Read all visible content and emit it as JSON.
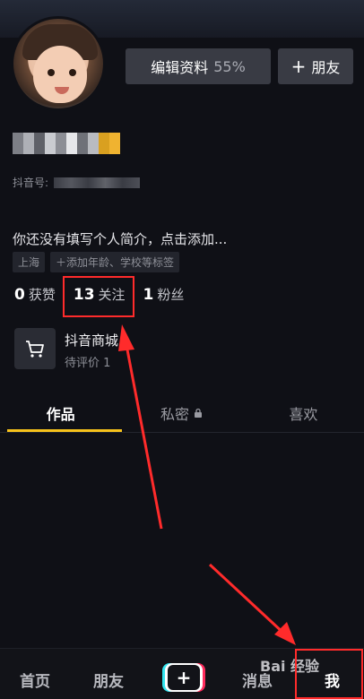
{
  "profile": {
    "edit_label": "编辑资料",
    "edit_percent": "55%",
    "friend_label": "朋友",
    "douyin_id_label": "抖音号:",
    "bio": "你还没有填写个人简介，点击添加...",
    "tags": [
      "上海",
      "＋添加年龄、学校等标签"
    ]
  },
  "stats": [
    {
      "num": "0",
      "label": "获赞"
    },
    {
      "num": "13",
      "label": "关注"
    },
    {
      "num": "1",
      "label": "粉丝"
    }
  ],
  "shop": {
    "title": "抖音商城",
    "subtitle": "待评价 1"
  },
  "tabs": [
    "作品",
    "私密",
    "喜欢"
  ],
  "nav": {
    "home": "首页",
    "friends": "朋友",
    "messages": "消息",
    "me": "我"
  },
  "watermark": "Bai 经验",
  "colors": {
    "accent": "#f6c21c",
    "highlight": "#ff2b2b"
  }
}
